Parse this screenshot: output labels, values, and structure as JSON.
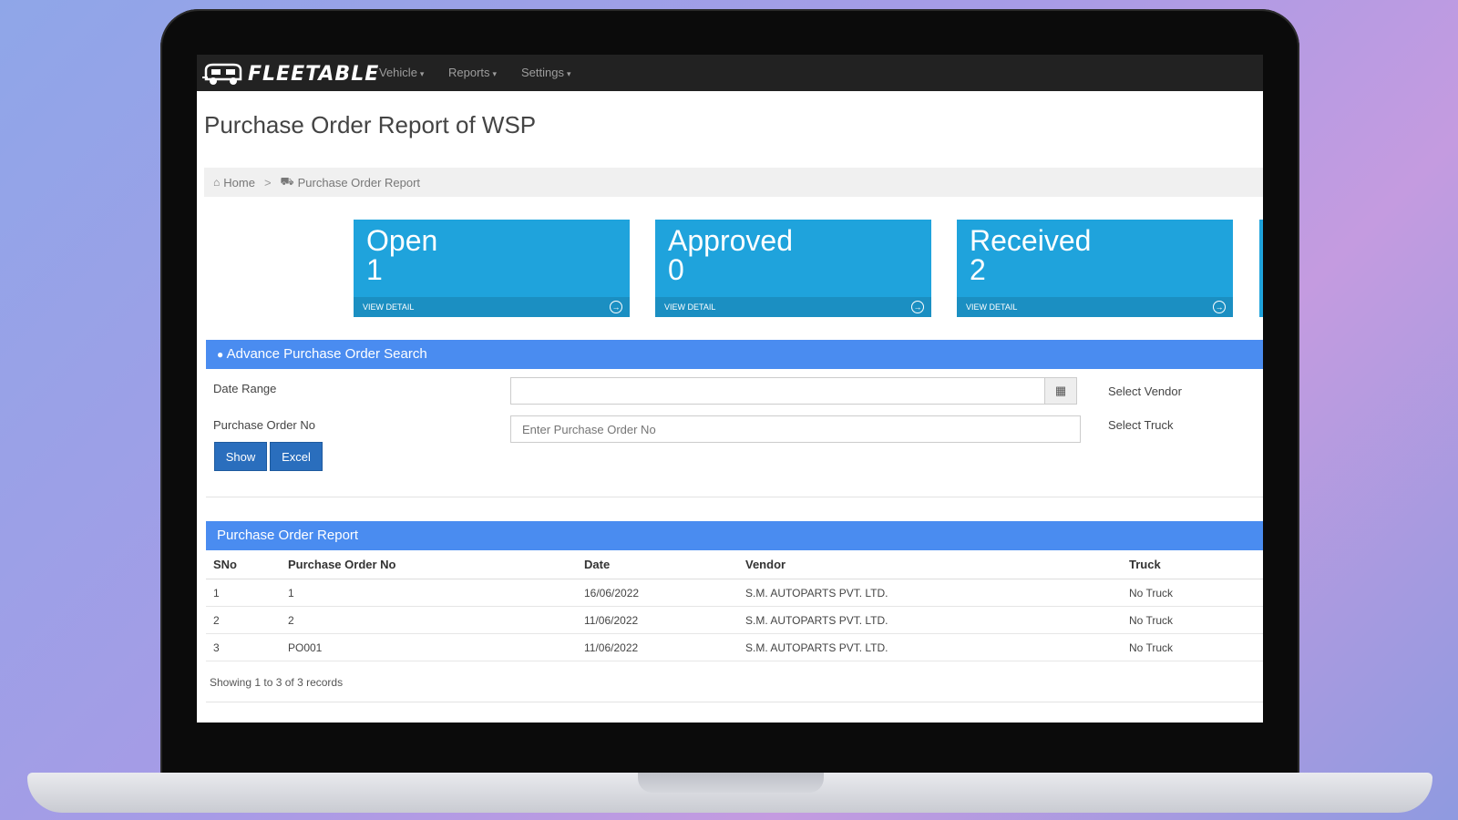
{
  "app": {
    "brand": "FLEETABLE",
    "nav": [
      {
        "label": "Vehicle"
      },
      {
        "label": "Reports"
      },
      {
        "label": "Settings"
      }
    ]
  },
  "page": {
    "title": "Purchase Order Report of WSP",
    "breadcrumb": {
      "home": "Home",
      "separator": ">",
      "current": "Purchase Order Report"
    }
  },
  "stats": [
    {
      "label": "Open",
      "value": "1",
      "footer": "VIEW DETAIL"
    },
    {
      "label": "Approved",
      "value": "0",
      "footer": "VIEW DETAIL"
    },
    {
      "label": "Received",
      "value": "2",
      "footer": "VIEW DETAIL"
    }
  ],
  "search": {
    "title": "Advance Purchase Order Search",
    "date_range_label": "Date Range",
    "date_range_value": "",
    "po_label": "Purchase Order No",
    "po_placeholder": "Enter Purchase Order No",
    "vendor_label": "Select Vendor",
    "truck_label": "Select Truck",
    "show_label": "Show",
    "excel_label": "Excel"
  },
  "report": {
    "title": "Purchase Order Report",
    "columns": [
      "SNo",
      "Purchase Order No",
      "Date",
      "Vendor",
      "Truck"
    ],
    "rows": [
      [
        "1",
        "1",
        "16/06/2022",
        "S.M. AUTOPARTS PVT. LTD.",
        "No Truck"
      ],
      [
        "2",
        "2",
        "11/06/2022",
        "S.M. AUTOPARTS PVT. LTD.",
        "No Truck"
      ],
      [
        "3",
        "PO001",
        "11/06/2022",
        "S.M. AUTOPARTS PVT. LTD.",
        "No Truck"
      ]
    ],
    "records_text": "Showing 1 to 3 of 3 records"
  },
  "colors": {
    "navbar": "#222222",
    "stat_card": "#1fa3dc",
    "panel_header": "#4a8cf0",
    "button": "#2a6ebd"
  }
}
